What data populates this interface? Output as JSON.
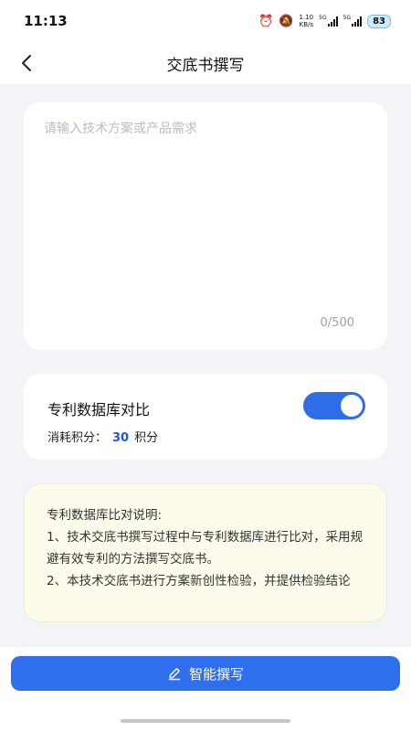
{
  "status_bar": {
    "time": "11:13",
    "net_speed_value": "1.10",
    "net_speed_unit": "KB/s",
    "signal1_label": "5G",
    "signal2_label": "5G",
    "battery": "83"
  },
  "header": {
    "title": "交底书撰写"
  },
  "input_card": {
    "placeholder": "请输入技术方案或产品需求",
    "value": "",
    "char_count": "0/500"
  },
  "compare_card": {
    "title": "专利数据库对比",
    "cost_label": "消耗积分：",
    "cost_value": "30",
    "cost_unit": "积分",
    "toggle_on": true
  },
  "note": {
    "line1": "专利数据库比对说明:",
    "line2": "1、技术交底书撰写过程中与专利数据库进行比对，采用规避有效专利的方法撰写交底书。",
    "line3": "2、本技术交底书进行方案新创性检验，并提供检验结论"
  },
  "action": {
    "label": "智能撰写"
  },
  "colors": {
    "accent": "#2f6fed",
    "cost_number": "#1e5ad8",
    "note_bg": "#fdfcec",
    "page_bg": "#f2f4f8"
  }
}
